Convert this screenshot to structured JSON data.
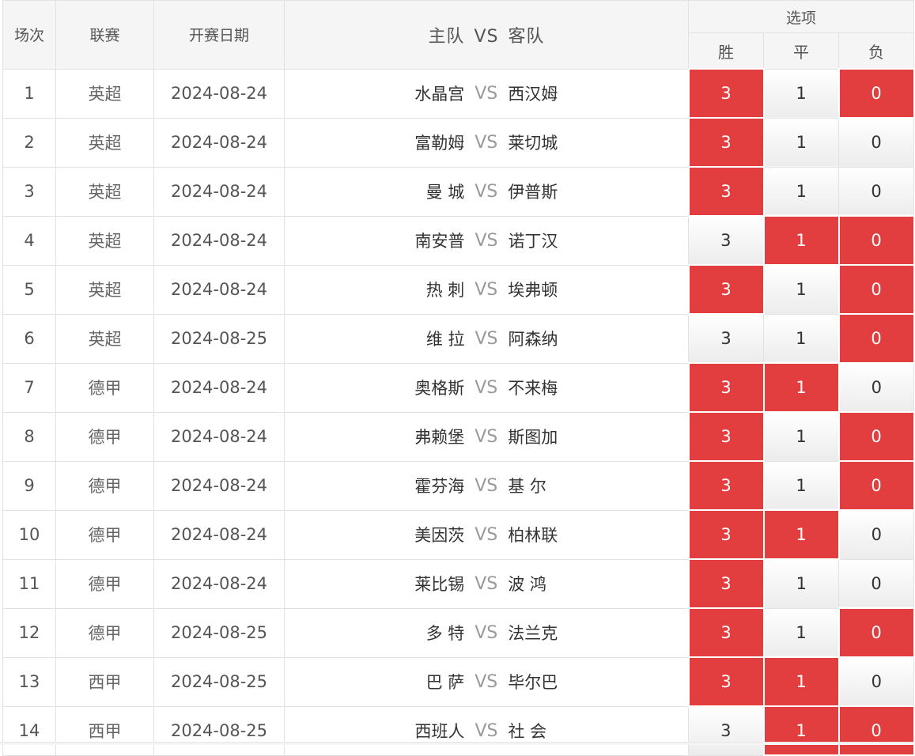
{
  "header": {
    "idx": "场次",
    "league": "联赛",
    "date": "开赛日期",
    "home": "主队",
    "vs": "VS",
    "away": "客队",
    "options": "选项",
    "win": "胜",
    "draw": "平",
    "lose": "负"
  },
  "option_values": {
    "win": "3",
    "draw": "1",
    "lose": "0"
  },
  "colors": {
    "selected": "#e23d3f",
    "selected_text": "#ffffff"
  },
  "rows": [
    {
      "idx": "1",
      "league": "英超",
      "date": "2024-08-24",
      "home": "水晶宫",
      "away": "西汉姆",
      "win": true,
      "draw": false,
      "lose": true
    },
    {
      "idx": "2",
      "league": "英超",
      "date": "2024-08-24",
      "home": "富勒姆",
      "away": "莱切城",
      "win": true,
      "draw": false,
      "lose": false
    },
    {
      "idx": "3",
      "league": "英超",
      "date": "2024-08-24",
      "home": "曼 城",
      "away": "伊普斯",
      "win": true,
      "draw": false,
      "lose": false
    },
    {
      "idx": "4",
      "league": "英超",
      "date": "2024-08-24",
      "home": "南安普",
      "away": "诺丁汉",
      "win": false,
      "draw": true,
      "lose": true
    },
    {
      "idx": "5",
      "league": "英超",
      "date": "2024-08-24",
      "home": "热 刺",
      "away": "埃弗顿",
      "win": true,
      "draw": false,
      "lose": true
    },
    {
      "idx": "6",
      "league": "英超",
      "date": "2024-08-25",
      "home": "维 拉",
      "away": "阿森纳",
      "win": false,
      "draw": false,
      "lose": true
    },
    {
      "idx": "7",
      "league": "德甲",
      "date": "2024-08-24",
      "home": "奥格斯",
      "away": "不来梅",
      "win": true,
      "draw": true,
      "lose": false
    },
    {
      "idx": "8",
      "league": "德甲",
      "date": "2024-08-24",
      "home": "弗赖堡",
      "away": "斯图加",
      "win": true,
      "draw": false,
      "lose": true
    },
    {
      "idx": "9",
      "league": "德甲",
      "date": "2024-08-24",
      "home": "霍芬海",
      "away": "基 尔",
      "win": true,
      "draw": false,
      "lose": true
    },
    {
      "idx": "10",
      "league": "德甲",
      "date": "2024-08-24",
      "home": "美因茨",
      "away": "柏林联",
      "win": true,
      "draw": true,
      "lose": false
    },
    {
      "idx": "11",
      "league": "德甲",
      "date": "2024-08-24",
      "home": "莱比锡",
      "away": "波 鸿",
      "win": true,
      "draw": false,
      "lose": false
    },
    {
      "idx": "12",
      "league": "德甲",
      "date": "2024-08-25",
      "home": "多 特",
      "away": "法兰克",
      "win": true,
      "draw": false,
      "lose": true
    },
    {
      "idx": "13",
      "league": "西甲",
      "date": "2024-08-25",
      "home": "巴 萨",
      "away": "毕尔巴",
      "win": true,
      "draw": true,
      "lose": false
    },
    {
      "idx": "14",
      "league": "西甲",
      "date": "2024-08-25",
      "home": "西班人",
      "away": "社 会",
      "win": false,
      "draw": true,
      "lose": true
    }
  ]
}
